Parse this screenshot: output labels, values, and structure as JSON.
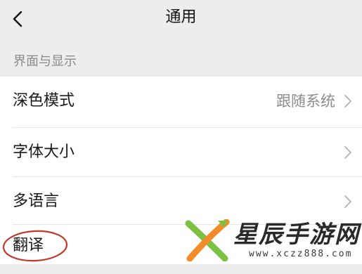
{
  "header": {
    "title": "通用"
  },
  "section": {
    "label": "界面与显示"
  },
  "settings": [
    {
      "label": "深色模式",
      "value": "跟随系统"
    },
    {
      "label": "字体大小",
      "value": ""
    },
    {
      "label": "多语言",
      "value": ""
    },
    {
      "label": "翻译",
      "value": ""
    }
  ],
  "watermark": {
    "brand": "星辰手游网",
    "url": "www.xczz888.com"
  },
  "colors": {
    "background": "#ededed",
    "annotation": "#c0392b",
    "watermark_x_green": "#7cc142",
    "watermark_x_orange": "#f28c28"
  }
}
